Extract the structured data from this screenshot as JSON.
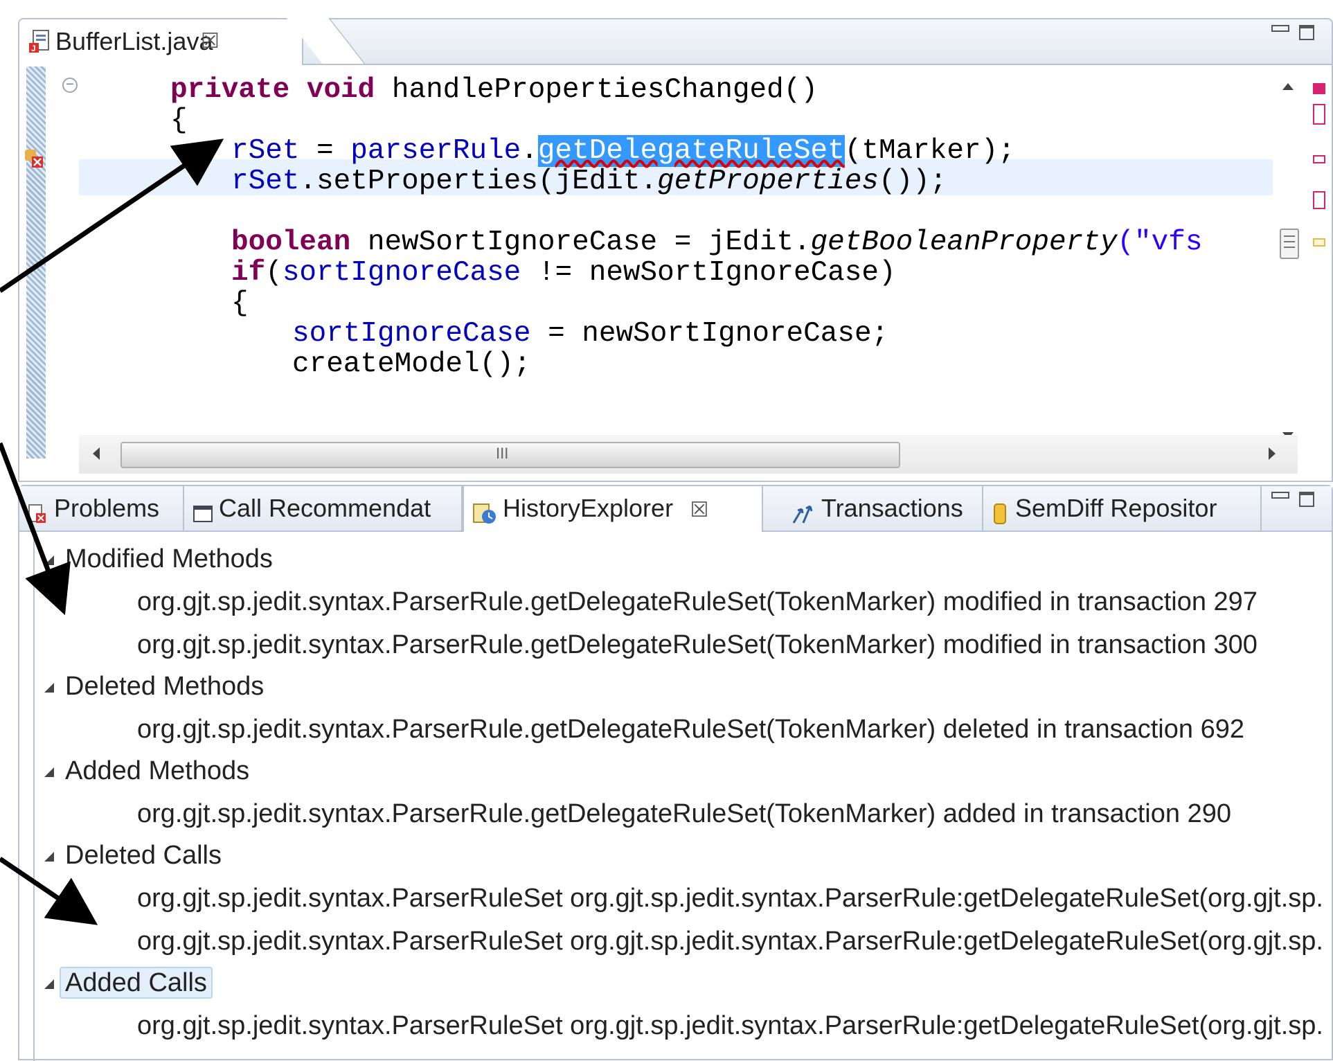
{
  "editor": {
    "tab": {
      "title": "BufferList.java",
      "icon": "java-file-icon",
      "close": "☒"
    },
    "code": {
      "line1": {
        "kw1": "private",
        "kw2": "void",
        "rest": " handlePropertiesChanged()"
      },
      "line2": "{",
      "line3": {
        "var": "rSet",
        "eq": " = ",
        "obj": "parserRule",
        "dot": ".",
        "method": "getDelegateRuleSet",
        "args": "(tMarker);"
      },
      "line4": {
        "var": "rSet",
        "pre": ".setProperties(jEdit.",
        "it": "getProperties",
        "post": "());"
      },
      "line5": {
        "kw": "boolean",
        "pre": " newSortIgnoreCase = jEdit.",
        "it": "getBooleanProperty",
        "str": "(\"vfs"
      },
      "line6": {
        "kw": "if",
        "pre": "(",
        "fld": "sortIgnoreCase",
        "post": " != newSortIgnoreCase)"
      },
      "line7": "{",
      "line8": {
        "fld": "sortIgnoreCase",
        "post": " = newSortIgnoreCase;"
      },
      "line9": "createModel();"
    },
    "scroll_thumb_label": "III"
  },
  "view": {
    "tabs": [
      {
        "label": "Problems",
        "icon": "problems-icon"
      },
      {
        "label": "Call Recommendat",
        "icon": "window-icon"
      },
      {
        "label": "HistoryExplorer",
        "icon": "history-icon",
        "active": true,
        "close": "☒"
      },
      {
        "label": "Transactions",
        "icon": "transactions-icon"
      },
      {
        "label": "SemDiff Repositor",
        "icon": "repository-icon"
      }
    ],
    "tree": [
      {
        "category": "Modified Methods",
        "items": [
          "org.gjt.sp.jedit.syntax.ParserRule.getDelegateRuleSet(TokenMarker) modified in transaction 297",
          "org.gjt.sp.jedit.syntax.ParserRule.getDelegateRuleSet(TokenMarker) modified in transaction 300"
        ]
      },
      {
        "category": "Deleted Methods",
        "items": [
          "org.gjt.sp.jedit.syntax.ParserRule.getDelegateRuleSet(TokenMarker) deleted in transaction 692"
        ]
      },
      {
        "category": "Added Methods",
        "items": [
          "org.gjt.sp.jedit.syntax.ParserRule.getDelegateRuleSet(TokenMarker) added in transaction 290"
        ]
      },
      {
        "category": "Deleted Calls",
        "items": [
          "org.gjt.sp.jedit.syntax.ParserRuleSet org.gjt.sp.jedit.syntax.ParserRule:getDelegateRuleSet(org.gjt.sp.",
          "org.gjt.sp.jedit.syntax.ParserRuleSet org.gjt.sp.jedit.syntax.ParserRule:getDelegateRuleSet(org.gjt.sp."
        ]
      },
      {
        "category": "Added Calls",
        "items": [
          "org.gjt.sp.jedit.syntax.ParserRuleSet org.gjt.sp.jedit.syntax.ParserRule:getDelegateRuleSet(org.gjt.sp."
        ]
      }
    ]
  },
  "colors": {
    "keyword": "#7f0055",
    "field": "#0000c0",
    "selection": "#3399ff",
    "string": "#2a00ff",
    "border": "#b7c3d3"
  }
}
